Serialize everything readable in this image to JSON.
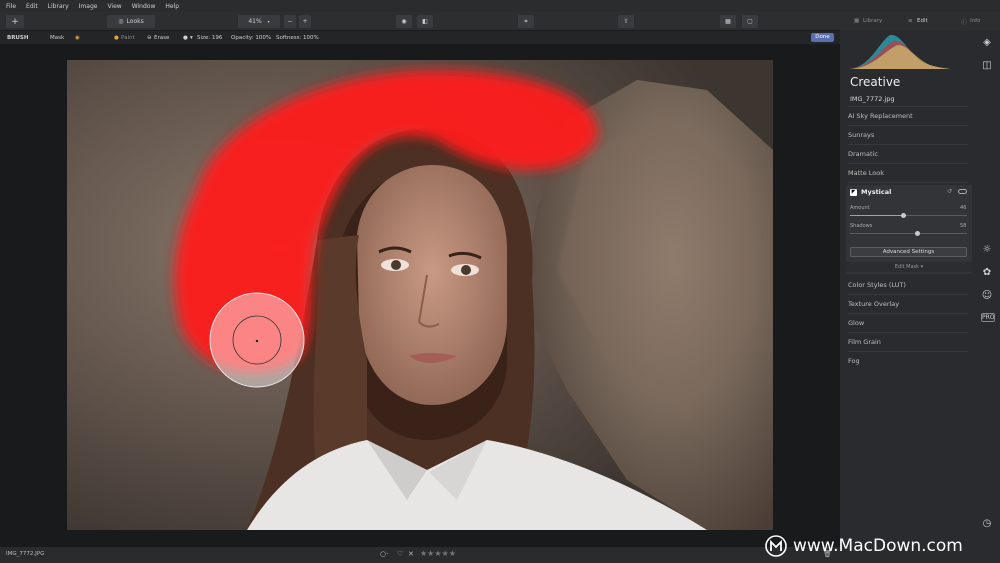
{
  "menu": [
    "File",
    "Edit",
    "Library",
    "Image",
    "View",
    "Window",
    "Help"
  ],
  "toolbar": {
    "add_label": "+",
    "looks_label": "Looks",
    "zoom_value": "41%",
    "zoom_minus": "−",
    "zoom_plus": "+"
  },
  "panel_tabs": {
    "library": "Library",
    "edit": "Edit",
    "info": "Info"
  },
  "brushbar": {
    "tool": "BRUSH",
    "mask": "Mask",
    "paint": "Paint",
    "erase": "Erase",
    "size": "Size: 196",
    "opacity": "Opacity: 100%",
    "softness": "Softness: 100%",
    "done": "Done"
  },
  "panel": {
    "section_title": "Creative",
    "filename": "IMG_7772.jpg",
    "items_top": [
      "AI Sky Replacement",
      "Sunrays",
      "Dramatic",
      "Matte Look"
    ],
    "mystical": {
      "title": "Mystical",
      "amount_label": "Amount",
      "amount_value": "46",
      "shadows_label": "Shadows",
      "shadows_value": "58",
      "advanced": "Advanced Settings",
      "edit_mask": "Edit Mask ▾",
      "amount_fraction": 0.46,
      "shadows_fraction": 0.58
    },
    "items_bottom": [
      "Color Styles (LUT)",
      "Texture Overlay",
      "Glow",
      "Film Grain",
      "Fog"
    ]
  },
  "status": {
    "filename": "IMG_7772.JPG",
    "stars": "★★★★★"
  },
  "watermark": {
    "text": "www.MacDown.com"
  },
  "colors": {
    "accent": "#5b6fb0",
    "mask_red": "#ff1a1a",
    "panel_bg": "#2a2b2e"
  }
}
